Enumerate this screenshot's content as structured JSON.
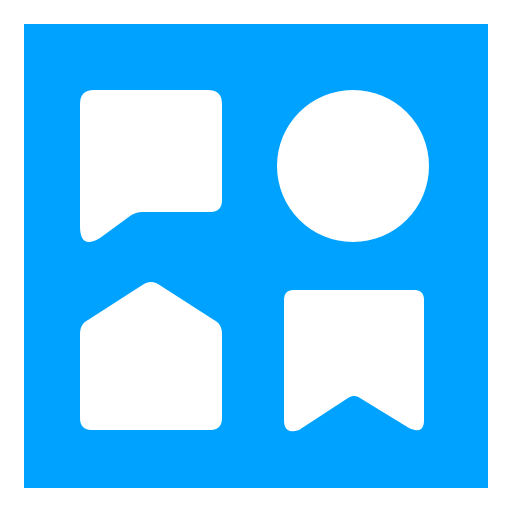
{
  "app_icon": {
    "background_color": "#00A2FF",
    "foreground_color": "#FFFFFF",
    "glyphs": [
      "chat-bubble-icon",
      "circle-icon",
      "house-icon",
      "bookmark-icon"
    ]
  }
}
